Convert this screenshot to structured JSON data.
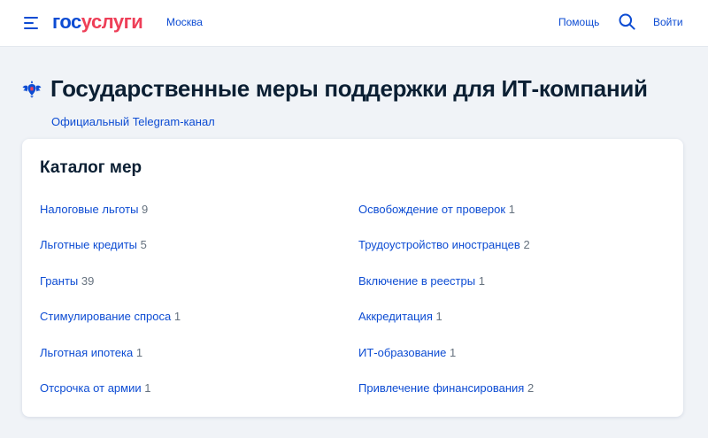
{
  "header": {
    "logo_part1": "гос",
    "logo_part2": "услуги",
    "city": "Москва",
    "help_label": "Помощь",
    "login_label": "Войти"
  },
  "page": {
    "title": "Государственные меры поддержки для ИТ-компаний",
    "telegram_link": "Официальный Telegram-канал"
  },
  "catalog": {
    "title": "Каталог мер",
    "left": [
      {
        "label": "Налоговые льготы",
        "count": "9"
      },
      {
        "label": "Льготные кредиты",
        "count": "5"
      },
      {
        "label": "Гранты",
        "count": "39"
      },
      {
        "label": "Стимулирование спроса",
        "count": "1"
      },
      {
        "label": "Льготная ипотека",
        "count": "1"
      },
      {
        "label": "Отсрочка от армии",
        "count": "1"
      }
    ],
    "right": [
      {
        "label": "Освобождение от проверок",
        "count": "1"
      },
      {
        "label": "Трудоустройство иностранцев",
        "count": "2"
      },
      {
        "label": "Включение в реестры",
        "count": "1"
      },
      {
        "label": "Аккредитация",
        "count": "1"
      },
      {
        "label": "ИТ-образование",
        "count": "1"
      },
      {
        "label": "Привлечение финансирования",
        "count": "2"
      }
    ]
  },
  "colors": {
    "brand_blue": "#0d4cd3",
    "brand_red": "#ee3f58",
    "text_dark": "#0b1f33",
    "count_grey": "#66727f",
    "page_bg": "#f0f3f7"
  },
  "icons": {
    "menu": "burger-menu-icon",
    "search": "search-icon",
    "emblem": "coat-of-arms-icon"
  }
}
